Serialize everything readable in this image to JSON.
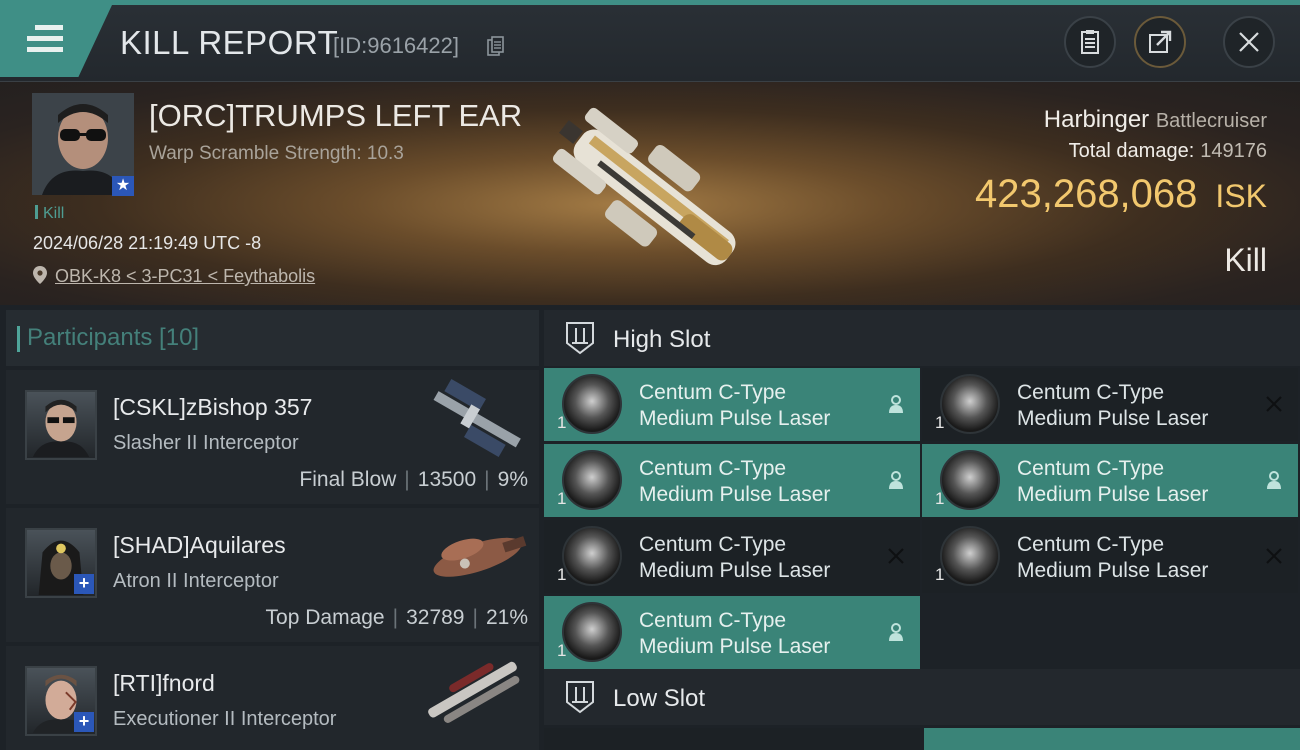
{
  "header": {
    "title": "KILL REPORT",
    "report_id": "[ID:9616422]"
  },
  "victim": {
    "name": "[ORC]TRUMPS LEFT EAR",
    "warp": "Warp Scramble Strength: 10.3",
    "kill_tag": "Kill",
    "time": "2024/06/28 21:19:49 UTC -8",
    "location": "OBK-K8 < 3-PC31 < Feythabolis",
    "ship_name": "Harbinger",
    "ship_class": "Battlecruiser",
    "total_damage_label": "Total damage:",
    "total_damage": "149176",
    "isk_value": "423,268,068",
    "isk_unit": "ISK",
    "result": "Kill"
  },
  "participants": {
    "label": "Participants [10]",
    "rows": [
      {
        "name": "[CSKL]zBishop 357",
        "ship": "Slasher II Interceptor",
        "role": "Final Blow",
        "damage": "13500",
        "percent": "9%"
      },
      {
        "name": "[SHAD]Aquilares",
        "ship": "Atron II Interceptor",
        "role": "Top Damage",
        "damage": "32789",
        "percent": "21%"
      },
      {
        "name": "[RTI]fnord",
        "ship": "Executioner II Interceptor",
        "role": "",
        "damage": "",
        "percent": ""
      }
    ]
  },
  "slots": {
    "high_label": "High Slot",
    "low_label": "Low Slot",
    "high_modules": [
      {
        "line1": "Centum C-Type",
        "line2": "Medium Pulse Laser",
        "qty": "1",
        "status": "person"
      },
      {
        "line1": "Centum C-Type",
        "line2": "Medium Pulse Laser",
        "qty": "1",
        "status": "destroyed"
      },
      {
        "line1": "Centum C-Type",
        "line2": "Medium Pulse Laser",
        "qty": "1",
        "status": "person"
      },
      {
        "line1": "Centum C-Type",
        "line2": "Medium Pulse Laser",
        "qty": "1",
        "status": "person"
      },
      {
        "line1": "Centum C-Type",
        "line2": "Medium Pulse Laser",
        "qty": "1",
        "status": "destroyed"
      },
      {
        "line1": "Centum C-Type",
        "line2": "Medium Pulse Laser",
        "qty": "1",
        "status": "destroyed"
      },
      {
        "line1": "Centum C-Type",
        "line2": "Medium Pulse Laser",
        "qty": "1",
        "status": "person"
      }
    ]
  },
  "colors": {
    "accent": "#3f8f86",
    "isk": "#f2c86e",
    "active_module": "#3a8478"
  }
}
